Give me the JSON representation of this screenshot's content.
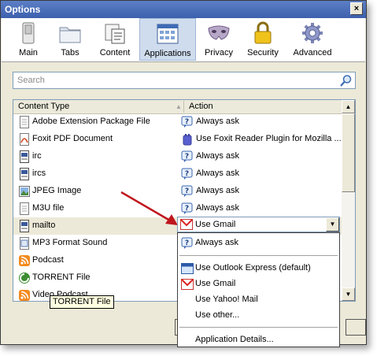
{
  "window": {
    "title": "Options",
    "close_label": "×"
  },
  "toolbar": {
    "tabs": [
      {
        "label": "Main",
        "icon": "switch-icon"
      },
      {
        "label": "Tabs",
        "icon": "folder-icon"
      },
      {
        "label": "Content",
        "icon": "content-icon"
      },
      {
        "label": "Applications",
        "icon": "applications-icon",
        "selected": true
      },
      {
        "label": "Privacy",
        "icon": "mask-icon"
      },
      {
        "label": "Security",
        "icon": "padlock-icon"
      },
      {
        "label": "Advanced",
        "icon": "gear-icon"
      }
    ]
  },
  "search": {
    "placeholder": "Search"
  },
  "table": {
    "col_content_type": "Content Type",
    "col_action": "Action",
    "rows": [
      {
        "type": "Adobe Extension Package File",
        "type_icon": "file-icon",
        "action": "Always ask",
        "action_icon": "ask-icon"
      },
      {
        "type": "Foxit PDF Document",
        "type_icon": "pdf-icon",
        "action": "Use Foxit Reader Plugin for Mozilla ...",
        "action_icon": "plugin-icon"
      },
      {
        "type": "irc",
        "type_icon": "protocol-icon",
        "action": "Always ask",
        "action_icon": "ask-icon"
      },
      {
        "type": "ircs",
        "type_icon": "protocol-icon",
        "action": "Always ask",
        "action_icon": "ask-icon"
      },
      {
        "type": "JPEG Image",
        "type_icon": "image-icon",
        "action": "Always ask",
        "action_icon": "ask-icon"
      },
      {
        "type": "M3U file",
        "type_icon": "file-icon",
        "action": "Always ask",
        "action_icon": "ask-icon"
      },
      {
        "type": "mailto",
        "type_icon": "protocol-icon",
        "action": "Use Gmail",
        "action_icon": "gmail-icon",
        "selected": true
      },
      {
        "type": "MP3 Format Sound",
        "type_icon": "audio-icon",
        "action": "",
        "action_icon": ""
      },
      {
        "type": "Podcast",
        "type_icon": "feed-icon",
        "action": "",
        "action_icon": ""
      },
      {
        "type": "TORRENT File",
        "type_icon": "torrent-icon",
        "action": "",
        "action_icon": ""
      },
      {
        "type": "Video Podcast",
        "type_icon": "feed-icon",
        "action": "",
        "action_icon": ""
      }
    ]
  },
  "combo": {
    "value": "Use Gmail"
  },
  "dropdown": {
    "items": [
      {
        "label": "Always ask",
        "icon": "ask-icon"
      },
      {
        "label": "Use Outlook Express (default)",
        "icon": "outlook-icon"
      },
      {
        "label": "Use Gmail",
        "icon": "gmail-icon"
      },
      {
        "label": "Use Yahoo! Mail",
        "icon": ""
      },
      {
        "label": "Use other...",
        "icon": ""
      },
      {
        "label": "Application Details...",
        "icon": ""
      }
    ]
  },
  "tooltip": {
    "text": "TORRENT File"
  },
  "colors": {
    "title_bar": "#3d60ad",
    "selected_tab": "#cfdcee",
    "window_bg": "#ece9d8",
    "annotation_arrow": "#c0161e"
  }
}
